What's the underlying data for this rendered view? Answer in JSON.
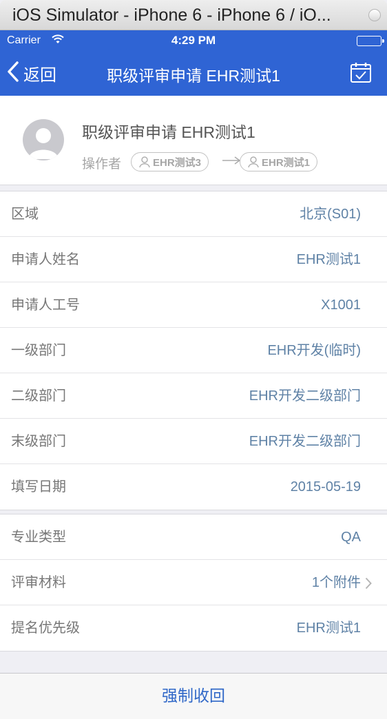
{
  "window": {
    "title": "iOS Simulator - iPhone 6 - iPhone 6 / iO..."
  },
  "status_bar": {
    "carrier": "Carrier",
    "time": "4:29 PM"
  },
  "nav": {
    "back_label": "返回",
    "title": "职级评审申请 EHR测试1",
    "icon": "calendar-check-icon"
  },
  "header": {
    "title": "职级评审申请 EHR测试1",
    "operator_label": "操作者",
    "from": "EHR测试3",
    "to": "EHR测试1"
  },
  "section1": [
    {
      "label": "区域",
      "value": "北京(S01)"
    },
    {
      "label": "申请人姓名",
      "value": "EHR测试1"
    },
    {
      "label": "申请人工号",
      "value": "X1001"
    },
    {
      "label": "一级部门",
      "value": "EHR开发(临时)"
    },
    {
      "label": "二级部门",
      "value": "EHR开发二级部门"
    },
    {
      "label": "末级部门",
      "value": "EHR开发二级部门"
    },
    {
      "label": "填写日期",
      "value": "2015-05-19"
    }
  ],
  "section2": [
    {
      "label": "专业类型",
      "value": "QA"
    },
    {
      "label": "评审材料",
      "value": "1个附件"
    },
    {
      "label": "提名优先级",
      "value": "EHR测试1"
    }
  ],
  "bottom": {
    "action_label": "强制收回"
  }
}
